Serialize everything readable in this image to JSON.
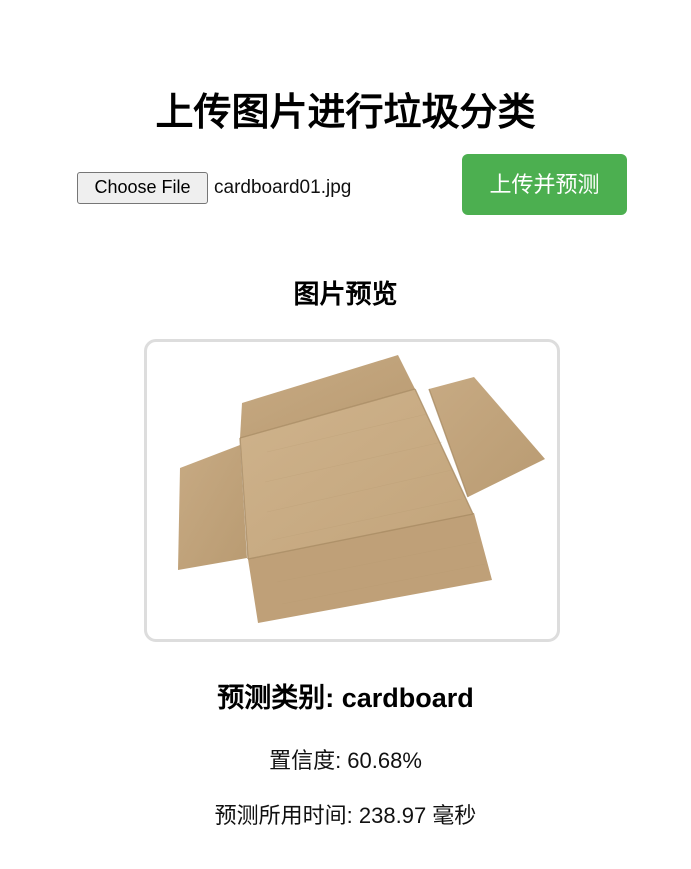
{
  "page": {
    "title": "上传图片进行垃圾分类"
  },
  "upload": {
    "choose_file_label": "Choose File",
    "file_name": "cardboard01.jpg",
    "submit_label": "上传并预测"
  },
  "preview": {
    "heading": "图片预览",
    "image_subject": "flattened cardboard box"
  },
  "result": {
    "category_text": "预测类别: cardboard",
    "confidence_text": "置信度: 60.68%",
    "time_text": "预测所用时间: 238.97 毫秒"
  },
  "colors": {
    "accent": "#4caf50",
    "frame_border": "#dddddd",
    "cardboard": "#c9ad86"
  }
}
